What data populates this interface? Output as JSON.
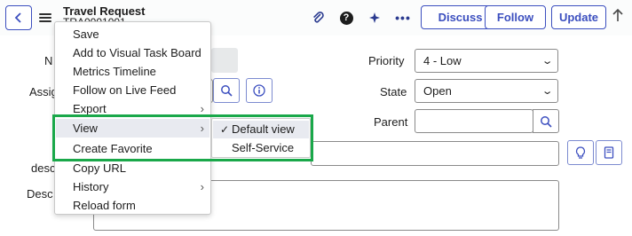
{
  "header": {
    "title": "Travel Request",
    "number": "TRA0001001",
    "buttons": {
      "discuss": "Discuss",
      "follow": "Follow",
      "update": "Update"
    },
    "icons": [
      "back-arrow-icon",
      "hamburger-menu-icon",
      "paperclip-icon",
      "help-icon",
      "activity-icon",
      "more-options-icon",
      "up-arrow-icon"
    ]
  },
  "form": {
    "labels": {
      "number": "N",
      "assigned": "Assig",
      "desc_short": "desc",
      "desc_long": "Desc"
    },
    "priority": {
      "label": "Priority",
      "value": "4 - Low"
    },
    "state": {
      "label": "State",
      "value": "Open"
    },
    "parent": {
      "label": "Parent",
      "value": ""
    }
  },
  "context_menu": {
    "items": [
      {
        "label": "Save",
        "submenu": false
      },
      {
        "label": "Add to Visual Task Board",
        "submenu": false
      },
      {
        "label": "Metrics Timeline",
        "submenu": false
      },
      {
        "label": "Follow on Live Feed",
        "submenu": false
      },
      {
        "label": "Export",
        "submenu": true
      },
      {
        "label": "View",
        "submenu": true
      },
      {
        "label": "Create Favorite",
        "submenu": false
      },
      {
        "label": "Copy URL",
        "submenu": false
      },
      {
        "label": "History",
        "submenu": true
      },
      {
        "label": "Reload form",
        "submenu": false
      }
    ],
    "view_submenu": [
      {
        "label": "Default view",
        "checked": true
      },
      {
        "label": "Self-Service",
        "checked": false
      }
    ]
  },
  "colors": {
    "accent": "#3c4fbf",
    "highlight": "#1aa84a",
    "menu_hover": "#e8eaf0"
  }
}
